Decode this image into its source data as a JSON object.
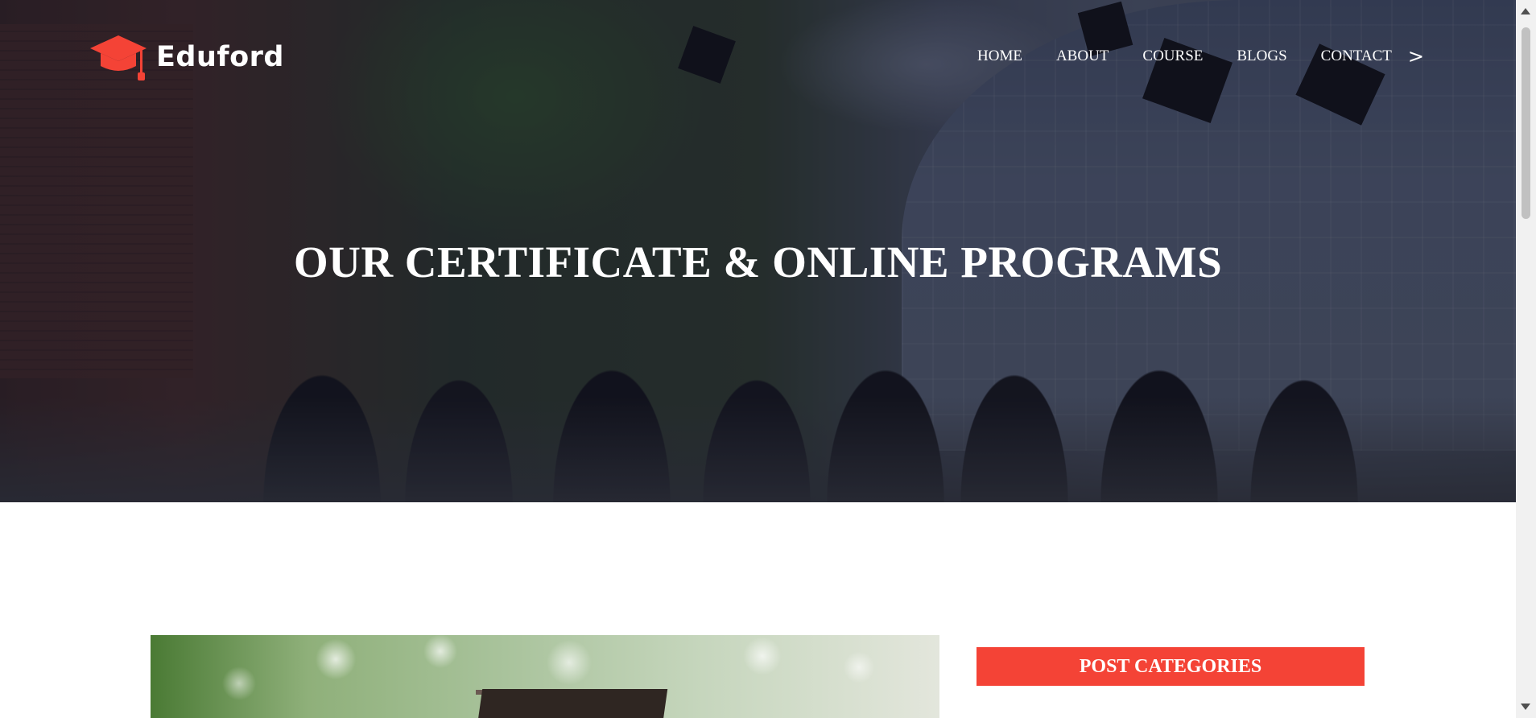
{
  "brand": {
    "name": "Eduford",
    "logo_icon": "graduation-cap-icon",
    "accent": "#f44336"
  },
  "nav": {
    "items": [
      {
        "label": "HOME"
      },
      {
        "label": "ABOUT"
      },
      {
        "label": "COURSE"
      },
      {
        "label": "BLOGS"
      },
      {
        "label": "CONTACT"
      }
    ],
    "more": ">"
  },
  "hero": {
    "title": "OUR CERTIFICATE & ONLINE PROGRAMS"
  },
  "sidebar": {
    "categories_title": "POST CATEGORIES"
  }
}
